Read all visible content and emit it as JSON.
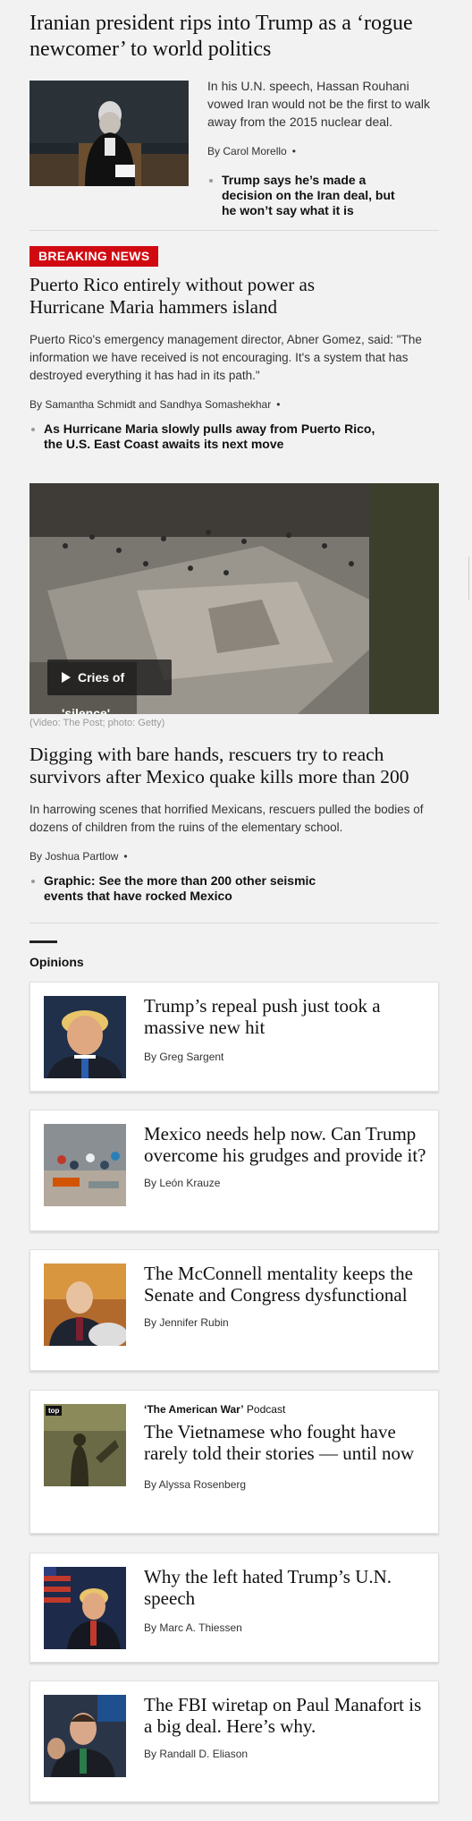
{
  "story1": {
    "headline": "Iranian president rips into Trump as a ‘rogue newcomer’ to world politics",
    "blurb": "In his U.N. speech, Hassan Rouhani vowed Iran would not be the first to walk away from the 2015 nuclear deal.",
    "by_prefix": "By",
    "author": "Carol Morello",
    "related": "Trump says he’s made a decision on the Iran deal, but he won’t say what it is"
  },
  "story2": {
    "badge": "BREAKING NEWS",
    "headline": "Puerto Rico entirely without power as Hurricane Maria hammers island",
    "blurb": "Puerto Rico's emergency management director, Abner Gomez, said: \"The information we have received is not encouraging. It's a system that has destroyed everything it has had in its path.\"",
    "by_prefix": "By",
    "author1": "Samantha Schmidt",
    "and": "and",
    "author2": "Sandhya Somashekhar",
    "related": "As Hurricane Maria slowly pulls away from Puerto Rico, the U.S. East Coast awaits its next move"
  },
  "story3": {
    "video_label": "Cries of 'silence'",
    "credit": "(Video: The Post; photo: Getty)",
    "headline": "Digging with bare hands, rescuers try to reach survivors after Mexico quake kills more than 200",
    "blurb": "In harrowing scenes that horrified Mexicans, rescuers pulled the bodies of dozens of children from the ruins of the elementary school.",
    "by_prefix": "By",
    "author": "Joshua Partlow",
    "related": "Graphic: See the more than 200 other seismic events that have rocked Mexico"
  },
  "opinions": {
    "section_label": "Opinions",
    "items": [
      {
        "title": "Trump’s repeal push just took a massive new hit",
        "byline": "By Greg Sargent"
      },
      {
        "title": "Mexico needs help now. Can Trump overcome his grudges and provide it?",
        "byline": "By León Krauze"
      },
      {
        "title": "The McConnell mentality keeps the Senate and Congress dysfunctional",
        "byline": "By Jennifer Rubin"
      },
      {
        "kicker_bold": "‘The American War’",
        "kicker_rest": " Podcast",
        "title": "The Vietnamese who fought have rarely told their stories — until now",
        "byline": "By Alyssa Rosenberg"
      },
      {
        "title": "Why the left hated Trump’s U.N. speech",
        "byline": "By Marc A. Thiessen"
      },
      {
        "title": "The FBI wiretap on Paul Manafort is a big deal. Here’s why.",
        "byline": "By Randall D. Eliason"
      }
    ]
  },
  "colors": {
    "breaking": "#d10a11",
    "background": "#f2f2f2",
    "rule": "#d9d9d9"
  }
}
